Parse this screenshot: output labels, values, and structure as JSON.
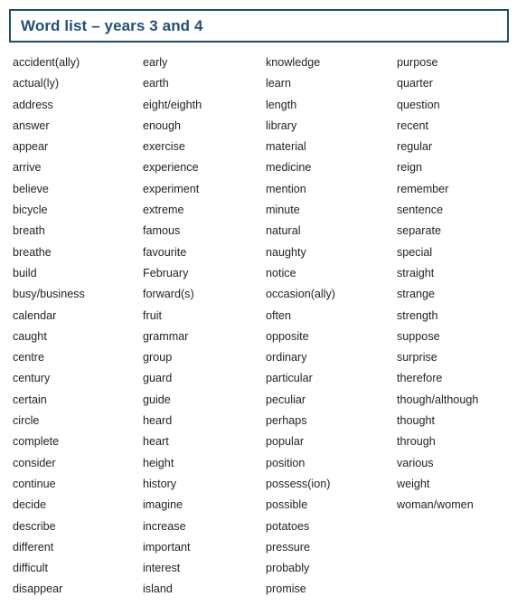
{
  "header": {
    "title": "Word list – years 3 and 4",
    "border_color": "#1f4e66",
    "title_color": "#1f5173"
  },
  "body": {
    "text_color": "#231f20",
    "background_color": "#ffffff"
  },
  "columns": [
    {
      "name": "column-1",
      "words": [
        "accident(ally)",
        "actual(ly)",
        "address",
        "answer",
        "appear",
        "arrive",
        "believe",
        "bicycle",
        "breath",
        "breathe",
        "build",
        "busy/business",
        "calendar",
        "caught",
        "centre",
        "century",
        "certain",
        "circle",
        "complete",
        "consider",
        "continue",
        "decide",
        "describe",
        "different",
        "difficult",
        "disappear"
      ]
    },
    {
      "name": "column-2",
      "words": [
        "early",
        "earth",
        "eight/eighth",
        "enough",
        "exercise",
        "experience",
        "experiment",
        "extreme",
        "famous",
        "favourite",
        "February",
        "forward(s)",
        "fruit",
        "grammar",
        "group",
        "guard",
        "guide",
        "heard",
        "heart",
        "height",
        "history",
        "imagine",
        "increase",
        "important",
        "interest",
        "island"
      ]
    },
    {
      "name": "column-3",
      "words": [
        "knowledge",
        "learn",
        "length",
        "library",
        "material",
        "medicine",
        "mention",
        "minute",
        "natural",
        "naughty",
        "notice",
        "occasion(ally)",
        "often",
        "opposite",
        "ordinary",
        "particular",
        "peculiar",
        "perhaps",
        "popular",
        "position",
        "possess(ion)",
        "possible",
        "potatoes",
        "pressure",
        "probably",
        "promise"
      ]
    },
    {
      "name": "column-4",
      "words": [
        "purpose",
        "quarter",
        "question",
        "recent",
        "regular",
        "reign",
        "remember",
        "sentence",
        "separate",
        "special",
        "straight",
        "strange",
        "strength",
        "suppose",
        "surprise",
        "therefore",
        "though/although",
        "thought",
        "through",
        "various",
        "weight",
        "woman/women"
      ]
    }
  ]
}
